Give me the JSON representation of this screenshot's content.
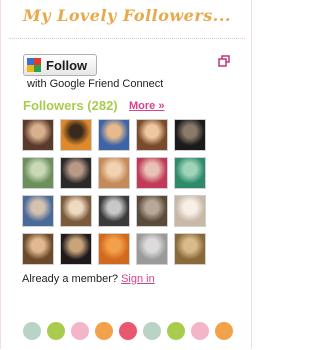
{
  "widget": {
    "title": "My Lovely Followers..."
  },
  "follow": {
    "button_label": "Follow",
    "provider_text": "with Google Friend Connect",
    "provider_icon": "google-friend-connect-icon",
    "popout_icon": "open-in-new-window-icon"
  },
  "followers": {
    "heading": "Followers (282)",
    "more_label": "More »",
    "avatars": [
      {
        "label": "follower-1",
        "colors": [
          "#5a3a2a",
          "#d9b08c"
        ]
      },
      {
        "label": "follower-2",
        "colors": [
          "#e0892a",
          "#3a2a1e"
        ]
      },
      {
        "label": "follower-3",
        "colors": [
          "#3c64a6",
          "#e8b98c"
        ]
      },
      {
        "label": "follower-4",
        "colors": [
          "#7a4a2a",
          "#efc8a0"
        ]
      },
      {
        "label": "follower-5",
        "colors": [
          "#1a1a1a",
          "#8a7a6a"
        ]
      },
      {
        "label": "follower-6",
        "colors": [
          "#6d8f5c",
          "#c9d9b8"
        ]
      },
      {
        "label": "follower-7",
        "colors": [
          "#2a2a2a",
          "#b89a86"
        ]
      },
      {
        "label": "follower-8",
        "colors": [
          "#c48a5a",
          "#f2d2b0"
        ]
      },
      {
        "label": "follower-9",
        "colors": [
          "#c23a5a",
          "#e9c2b4"
        ]
      },
      {
        "label": "follower-10",
        "colors": [
          "#2e8a6a",
          "#9fd4b8"
        ]
      },
      {
        "label": "follower-11",
        "colors": [
          "#4a6a9a",
          "#d4c2b0"
        ]
      },
      {
        "label": "follower-12",
        "colors": [
          "#7a5a3a",
          "#efd9c0"
        ]
      },
      {
        "label": "follower-13",
        "colors": [
          "#3a3a3a",
          "#c8c8c8"
        ]
      },
      {
        "label": "follower-14",
        "colors": [
          "#5a4a3a",
          "#b8a898"
        ]
      },
      {
        "label": "follower-15",
        "colors": [
          "#c8b8a8",
          "#f8f0e8"
        ]
      },
      {
        "label": "follower-16",
        "colors": [
          "#6a4a2a",
          "#e2b890"
        ]
      },
      {
        "label": "follower-17",
        "colors": [
          "#1e1a1a",
          "#c9a37a"
        ]
      },
      {
        "label": "follower-18",
        "colors": [
          "#d2691e",
          "#f3a04a"
        ]
      },
      {
        "label": "follower-19",
        "colors": [
          "#9a9a9a",
          "#dcdcdc"
        ]
      },
      {
        "label": "follower-20",
        "colors": [
          "#8a6a3a",
          "#d8bb8a"
        ]
      }
    ]
  },
  "membership": {
    "prompt": "Already a member?",
    "signin_label": "Sign in"
  },
  "decor": {
    "dot_colors": [
      "#b9d3c4",
      "#a9cc4e",
      "#f2b6c8",
      "#f2a24a",
      "#e8586e",
      "#b9d3c4",
      "#a9cc4e",
      "#f2b6c8",
      "#f2a24a"
    ]
  }
}
